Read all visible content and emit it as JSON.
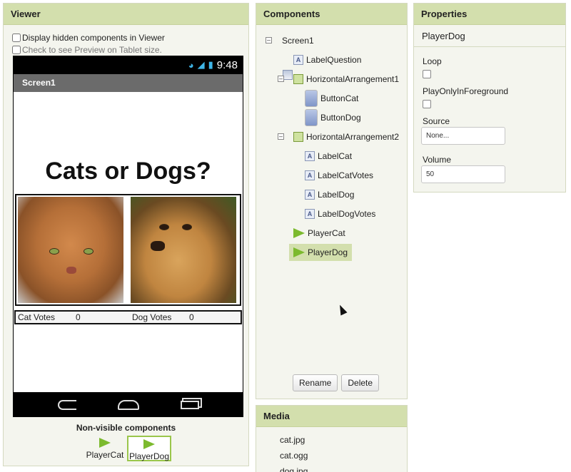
{
  "viewer": {
    "title": "Viewer",
    "opt_hidden": "Display hidden components in Viewer",
    "opt_tablet": "Check to see Preview on Tablet size.",
    "phone": {
      "time": "9:48",
      "screen_title": "Screen1",
      "question": "Cats or Dogs?",
      "cat_votes_label": "Cat Votes",
      "cat_votes_value": "0",
      "dog_votes_label": "Dog Votes",
      "dog_votes_value": "0"
    },
    "nonvisible_title": "Non-visible components",
    "nonvisible": [
      "PlayerCat",
      "PlayerDog"
    ]
  },
  "components": {
    "title": "Components",
    "tree": [
      {
        "label": "Screen1",
        "icon": "screen-icon"
      },
      {
        "label": "LabelQuestion",
        "icon": "label-icon"
      },
      {
        "label": "HorizontalArrangement1",
        "icon": "horizontal-arrangement-icon"
      },
      {
        "label": "ButtonCat",
        "icon": "button-icon"
      },
      {
        "label": "ButtonDog",
        "icon": "button-icon"
      },
      {
        "label": "HorizontalArrangement2",
        "icon": "horizontal-arrangement-icon"
      },
      {
        "label": "LabelCat",
        "icon": "label-icon"
      },
      {
        "label": "LabelCatVotes",
        "icon": "label-icon"
      },
      {
        "label": "LabelDog",
        "icon": "label-icon"
      },
      {
        "label": "LabelDogVotes",
        "icon": "label-icon"
      },
      {
        "label": "PlayerCat",
        "icon": "player-icon"
      },
      {
        "label": "PlayerDog",
        "icon": "player-icon",
        "selected": true
      }
    ],
    "rename": "Rename",
    "delete": "Delete"
  },
  "media": {
    "title": "Media",
    "items": [
      "cat.jpg",
      "cat.ogg",
      "dog.jpg"
    ]
  },
  "properties": {
    "title": "Properties",
    "component": "PlayerDog",
    "loop_label": "Loop",
    "play_fg_label": "PlayOnlyInForeground",
    "source_label": "Source",
    "source_value": "None...",
    "volume_label": "Volume",
    "volume_value": "50"
  },
  "colors": {
    "header": "#d3dfad",
    "panel": "#f4f5ee",
    "accent_green": "#7cba2e"
  }
}
